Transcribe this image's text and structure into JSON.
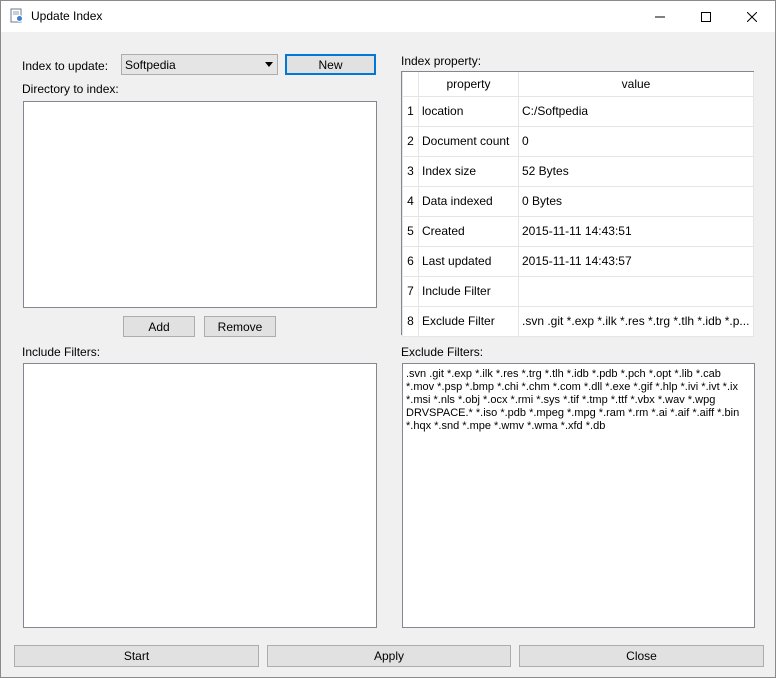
{
  "window": {
    "title": "Update Index"
  },
  "left": {
    "index_label": "Index to update:",
    "index_value": "Softpedia",
    "new_button": "New",
    "directory_label": "Directory to index:",
    "add_button": "Add",
    "remove_button": "Remove",
    "include_label": "Include Filters:"
  },
  "right": {
    "property_label": "Index property:",
    "table": {
      "headers": [
        "property",
        "value"
      ],
      "rows": [
        {
          "num": "1",
          "property": "location",
          "value": "C:/Softpedia"
        },
        {
          "num": "2",
          "property": "Document count",
          "value": "0"
        },
        {
          "num": "3",
          "property": "Index size",
          "value": "52 Bytes"
        },
        {
          "num": "4",
          "property": "Data indexed",
          "value": "0 Bytes"
        },
        {
          "num": "5",
          "property": "Created",
          "value": "2015-11-11 14:43:51"
        },
        {
          "num": "6",
          "property": "Last updated",
          "value": "2015-11-11 14:43:57"
        },
        {
          "num": "7",
          "property": "Include Filter",
          "value": ""
        },
        {
          "num": "8",
          "property": "Exclude Filter",
          "value": ".svn .git *.exp *.ilk *.res *.trg *.tlh *.idb *.p..."
        }
      ]
    },
    "exclude_label": "Exclude Filters:",
    "exclude_text": ".svn .git *.exp *.ilk *.res *.trg *.tlh *.idb *.pdb *.pch *.opt *.lib *.cab *.mov *.psp *.bmp *.chi *.chm *.com *.dll *.exe *.gif *.hlp *.ivi *.ivt *.ix *.msi *.nls *.obj *.ocx *.rmi *.sys *.tif *.tmp *.ttf *.vbx *.wav *.wpg DRVSPACE.* *.iso *.pdb *.mpeg *.mpg *.ram *.rm *.ai *.aif *.aiff *.bin *.hqx *.snd *.mpe *.wmv *.wma *.xfd *.db"
  },
  "bottom": {
    "start_button": "Start",
    "apply_button": "Apply",
    "close_button": "Close"
  },
  "colors": {
    "accent": "#0078d7",
    "window_bg": "#f0f0f0",
    "button_bg": "#e1e1e1"
  }
}
